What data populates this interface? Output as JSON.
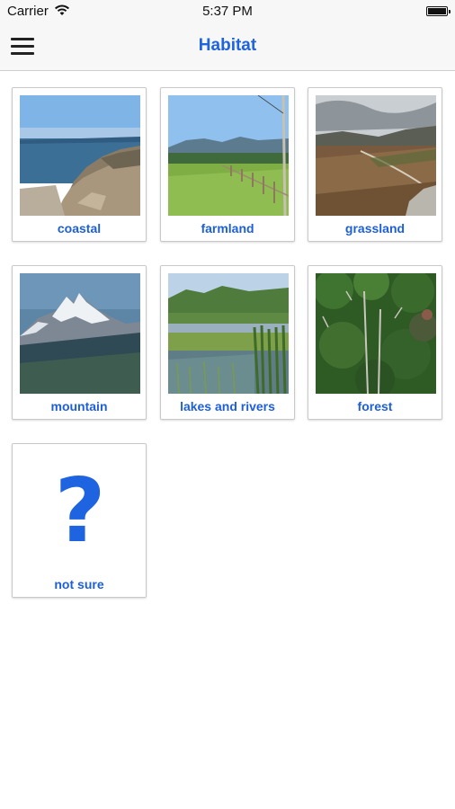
{
  "status_bar": {
    "carrier": "Carrier",
    "time": "5:37 PM"
  },
  "nav": {
    "title": "Habitat"
  },
  "habitats": [
    {
      "label": "coastal",
      "icon": "coastal-photo"
    },
    {
      "label": "farmland",
      "icon": "farmland-photo"
    },
    {
      "label": "grassland",
      "icon": "grassland-photo"
    },
    {
      "label": "mountain",
      "icon": "mountain-photo"
    },
    {
      "label": "lakes and rivers",
      "icon": "lakes-and-rivers-photo"
    },
    {
      "label": "forest",
      "icon": "forest-photo"
    },
    {
      "label": "not sure",
      "icon": "question-mark-icon",
      "glyph": "?"
    }
  ],
  "colors": {
    "accent": "#1e63e0",
    "label": "#1e5fd8",
    "nav_bg": "#f7f7f7"
  }
}
